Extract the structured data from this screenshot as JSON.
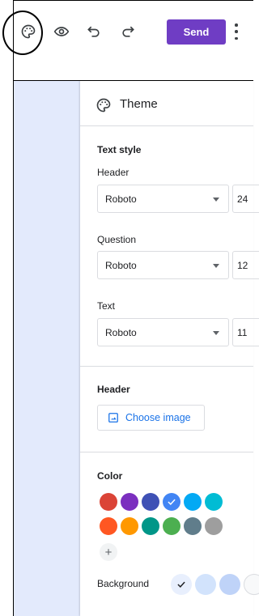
{
  "toolbar": {
    "icons": [
      "palette-icon",
      "eye-icon",
      "undo-icon",
      "redo-icon",
      "more-vert-icon"
    ],
    "send_label": "Send",
    "send_color": "#6f3dc4"
  },
  "panel": {
    "title": "Theme",
    "text_style": {
      "section_label": "Text style",
      "header_label": "Header",
      "header_font": "Roboto",
      "header_size": "24",
      "question_label": "Question",
      "question_font": "Roboto",
      "question_size": "12",
      "text_label": "Text",
      "text_font": "Roboto",
      "text_size": "11"
    },
    "header_section": {
      "label": "Header",
      "choose_image_label": "Choose image"
    },
    "color_section": {
      "label": "Color",
      "swatches": [
        "#db4437",
        "#7b2fbf",
        "#3f51b5",
        "#4285f4",
        "#03a9f4",
        "#00bcd4",
        "#ff5722",
        "#ff9800",
        "#009688",
        "#4caf50",
        "#607d8b",
        "#9e9e9e"
      ],
      "selected_index": 3,
      "add_label": "+",
      "background_label": "Background",
      "background_swatches": [
        "#e8effd",
        "#d2e3fc",
        "#bfd3f8",
        "#f8f9fa"
      ]
    }
  }
}
